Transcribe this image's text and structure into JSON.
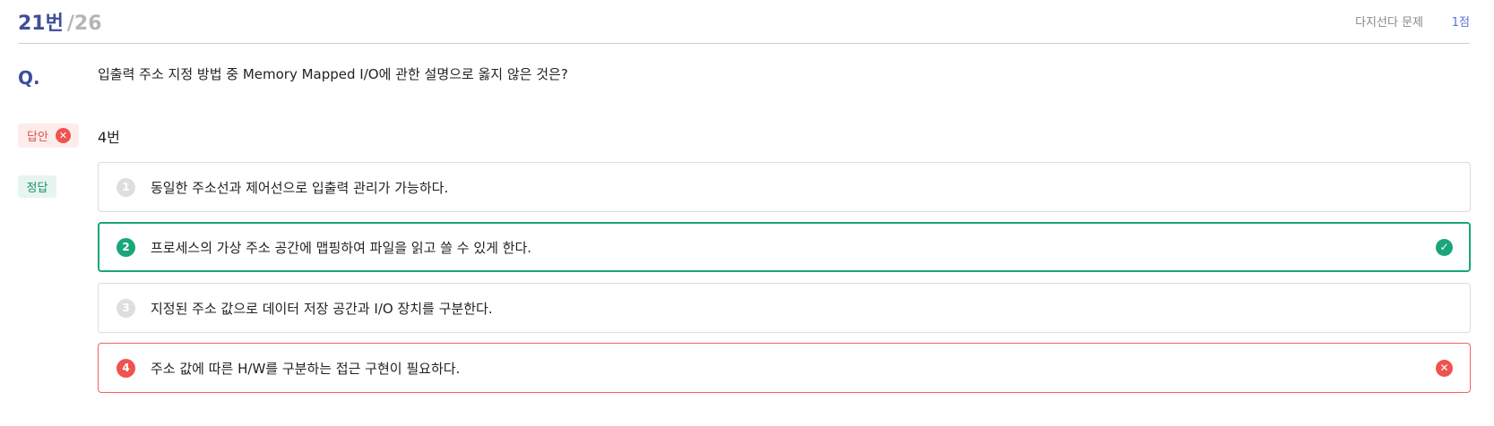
{
  "header": {
    "question_number": "21번",
    "question_total": "/26",
    "question_type": "다지선다 문제",
    "points": "1점"
  },
  "question": {
    "label": "Q.",
    "text": "입출력 주소 지정 방법 중 Memory Mapped I/O에 관한 설명으로 옳지 않은 것은?"
  },
  "answer": {
    "label": "답안",
    "status_icon": "x-circle-icon",
    "value": "4번"
  },
  "correct": {
    "label": "정답"
  },
  "options": [
    {
      "number": "1",
      "text": "동일한 주소선과 제어선으로 입출력 관리가 가능하다.",
      "state": "neutral"
    },
    {
      "number": "2",
      "text": "프로세스의 가상 주소 공간에 맵핑하여 파일을 읽고 쓸 수 있게 한다.",
      "state": "correct",
      "status_icon": "check-circle-icon"
    },
    {
      "number": "3",
      "text": "지정된 주소 값으로 데이터 저장 공간과 I/O 장치를 구분한다.",
      "state": "neutral"
    },
    {
      "number": "4",
      "text": "주소 값에 따른 H/W를 구분하는 접근 구현이 필요하다.",
      "state": "wrong",
      "status_icon": "x-circle-icon"
    }
  ],
  "colors": {
    "brand": "#3f4e9a",
    "correct": "#1aa57a",
    "wrong": "#ef5350",
    "points": "#5b74d4"
  }
}
